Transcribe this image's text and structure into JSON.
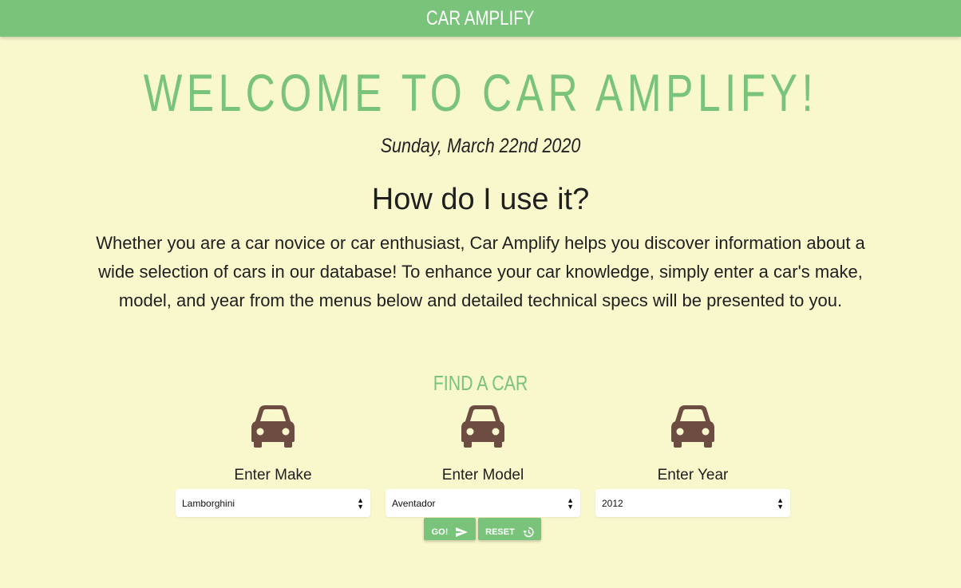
{
  "navbar": {
    "brand": "CAR AMPLIFY"
  },
  "hero": {
    "title": "WELCOME TO CAR AMPLIFY!",
    "date": "Sunday, March 22nd 2020"
  },
  "howto": {
    "heading": "How do I use it?",
    "description": "Whether you are a car novice or car enthusiast, Car Amplify helps you discover information about a wide selection of cars in our database! To enhance your car knowledge, simply enter a car's make, model, and year from the menus below and detailed technical specs will be presented to you."
  },
  "finder": {
    "title": "FIND A CAR",
    "fields": [
      {
        "label": "Enter Make",
        "selected": "Lamborghini",
        "icon": "car-icon"
      },
      {
        "label": "Enter Model",
        "selected": "Aventador",
        "icon": "car-icon"
      },
      {
        "label": "Enter Year",
        "selected": "2012",
        "icon": "car-icon"
      }
    ],
    "go_label": "GO!",
    "reset_label": "RESET"
  },
  "colors": {
    "accent": "#79c37a",
    "background": "#f9f8cd",
    "car_icon": "#6d4c41"
  }
}
